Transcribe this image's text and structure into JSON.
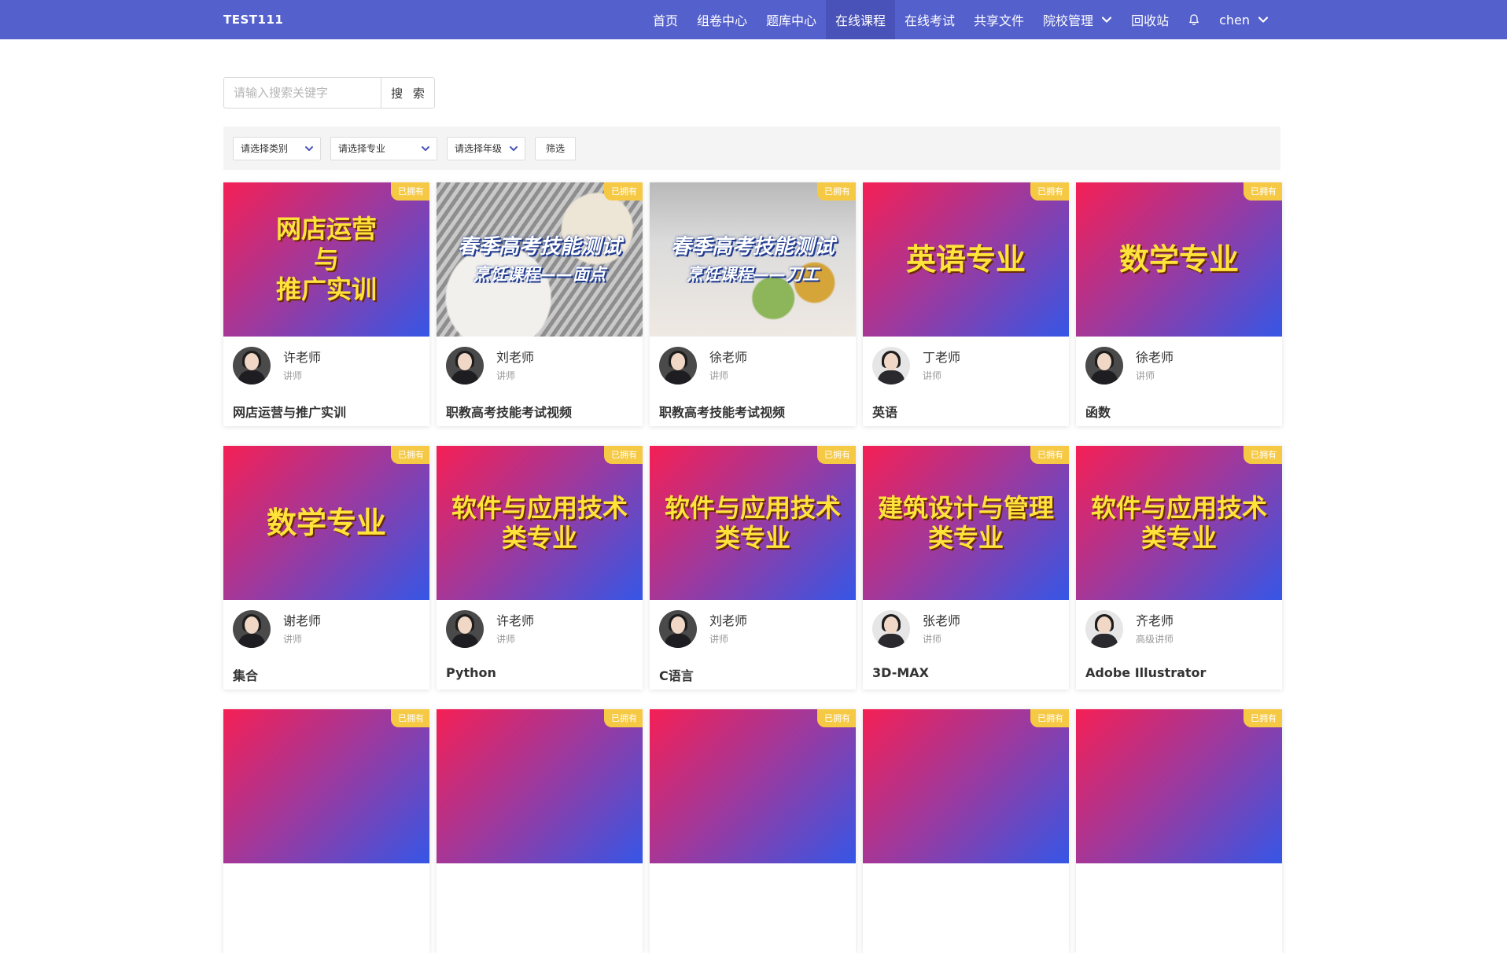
{
  "header": {
    "brand": "TEST111",
    "nav": [
      {
        "label": "首页",
        "active": false
      },
      {
        "label": "组卷中心",
        "active": false
      },
      {
        "label": "题库中心",
        "active": false
      },
      {
        "label": "在线课程",
        "active": true
      },
      {
        "label": "在线考试",
        "active": false
      },
      {
        "label": "共享文件",
        "active": false
      },
      {
        "label": "院校管理",
        "active": false,
        "dropdown": true
      },
      {
        "label": "回收站",
        "active": false
      }
    ],
    "notification_icon": "bell-icon",
    "user": "chen",
    "colors": {
      "bar": "#5460cb",
      "active": "#4852b8"
    }
  },
  "search": {
    "placeholder": "请输入搜索关键字",
    "button": "搜 索"
  },
  "filters": {
    "category": "请选择类别",
    "major": "请选择专业",
    "grade": "请选择年级",
    "apply": "筛选"
  },
  "badge_label": "已拥有",
  "courses": [
    {
      "cover_text": "网店运营\n与\n推广实训",
      "cover_style": "grad",
      "teacher": "许老师",
      "title": "讲师",
      "name": "网店运营与推广实训"
    },
    {
      "cover_text": "春季高考技能测试\n烹饪课程——面点",
      "cover_style": "photo",
      "teacher": "刘老师",
      "title": "讲师",
      "name": "职教高考技能考试视频"
    },
    {
      "cover_text": "春季高考技能测试\n烹饪课程——刀工",
      "cover_style": "photo2",
      "teacher": "徐老师",
      "title": "讲师",
      "name": "职教高考技能考试视频"
    },
    {
      "cover_text": "英语专业",
      "cover_style": "grad",
      "teacher": "丁老师",
      "title": "讲师",
      "name": "英语"
    },
    {
      "cover_text": "数学专业",
      "cover_style": "grad",
      "teacher": "徐老师",
      "title": "讲师",
      "name": "函数"
    },
    {
      "cover_text": "数学专业",
      "cover_style": "grad",
      "teacher": "谢老师",
      "title": "讲师",
      "name": "集合"
    },
    {
      "cover_text": "软件与应用技术\n类专业",
      "cover_style": "grad",
      "teacher": "许老师",
      "title": "讲师",
      "name": "Python"
    },
    {
      "cover_text": "软件与应用技术\n类专业",
      "cover_style": "grad",
      "teacher": "刘老师",
      "title": "讲师",
      "name": "C语言"
    },
    {
      "cover_text": "建筑设计与管理\n类专业",
      "cover_style": "grad",
      "teacher": "张老师",
      "title": "讲师",
      "name": "3D-MAX"
    },
    {
      "cover_text": "软件与应用技术\n类专业",
      "cover_style": "grad",
      "teacher": "齐老师",
      "title": "高级讲师",
      "name": "Adobe Illustrator"
    },
    {
      "cover_text": "",
      "cover_style": "grad",
      "teacher": "",
      "title": "",
      "name": ""
    },
    {
      "cover_text": "",
      "cover_style": "grad",
      "teacher": "",
      "title": "",
      "name": ""
    },
    {
      "cover_text": "",
      "cover_style": "grad",
      "teacher": "",
      "title": "",
      "name": ""
    },
    {
      "cover_text": "",
      "cover_style": "grad",
      "teacher": "",
      "title": "",
      "name": ""
    },
    {
      "cover_text": "",
      "cover_style": "grad",
      "teacher": "",
      "title": "",
      "name": ""
    }
  ]
}
